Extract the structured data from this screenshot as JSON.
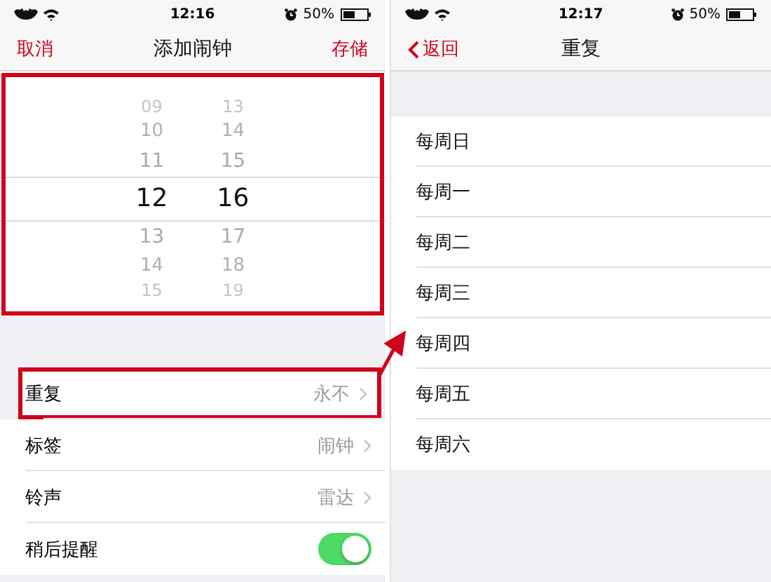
{
  "left_screen": {
    "status_bar": {
      "time": "12:16",
      "battery": "50%"
    },
    "nav": {
      "cancel": "取消",
      "title": "添加闹钟",
      "save": "存储"
    },
    "picker": {
      "highlighted": true,
      "columns": [
        {
          "items": [
            {
              "label": "09",
              "selected": false
            },
            {
              "label": "10",
              "selected": false
            },
            {
              "label": "11",
              "selected": false
            },
            {
              "label": "12",
              "selected": true
            },
            {
              "label": "13",
              "selected": false
            },
            {
              "label": "14",
              "selected": false
            },
            {
              "label": "15",
              "selected": false
            }
          ]
        },
        {
          "items": [
            {
              "label": "13",
              "selected": false
            },
            {
              "label": "14",
              "selected": false
            },
            {
              "label": "15",
              "selected": false
            },
            {
              "label": "16",
              "selected": true
            },
            {
              "label": "17",
              "selected": false
            },
            {
              "label": "18",
              "selected": false
            },
            {
              "label": "19",
              "selected": false
            }
          ]
        }
      ]
    },
    "settings": [
      {
        "kind": "link",
        "label": "重复",
        "value": "永不",
        "highlighted": true
      },
      {
        "kind": "link",
        "label": "标签",
        "value": "闹钟",
        "highlighted": false
      },
      {
        "kind": "link",
        "label": "铃声",
        "value": "雷达",
        "highlighted": false
      },
      {
        "kind": "toggle",
        "label": "稍后提醒",
        "on": true,
        "highlighted": false
      }
    ]
  },
  "right_screen": {
    "status_bar": {
      "time": "12:17",
      "battery": "50%"
    },
    "nav": {
      "back": "返回",
      "title": "重复"
    },
    "days": [
      {
        "label": "每周日"
      },
      {
        "label": "每周一"
      },
      {
        "label": "每周二"
      },
      {
        "label": "每周三"
      },
      {
        "label": "每周四"
      },
      {
        "label": "每周五"
      },
      {
        "label": "每周六"
      }
    ]
  }
}
